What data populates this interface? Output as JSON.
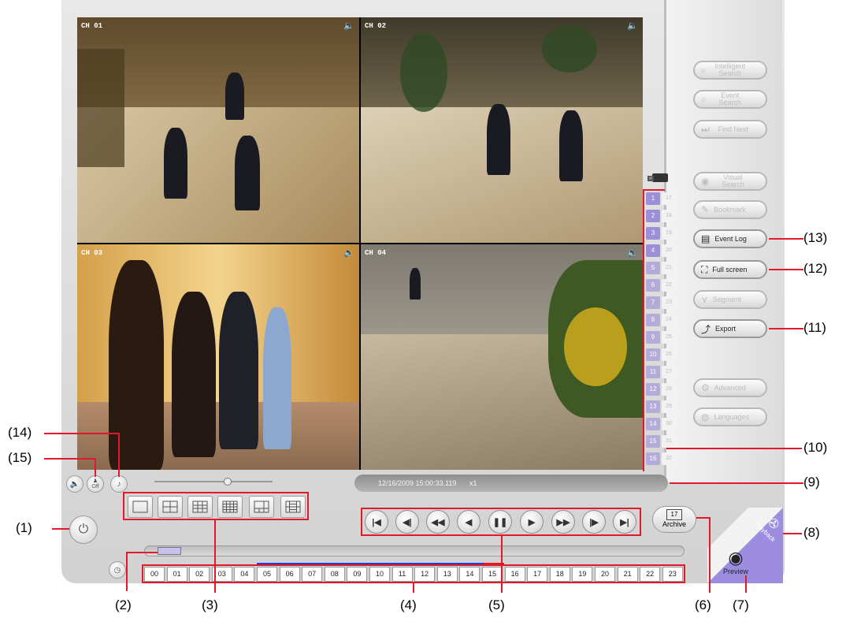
{
  "channels": {
    "cam1": {
      "label": "CH 01"
    },
    "cam2": {
      "label": "CH 02"
    },
    "cam3": {
      "label": "CH 03"
    },
    "cam4": {
      "label": "CH 04"
    },
    "audio_icon": "speaker-icon"
  },
  "status_bar": {
    "datetime": "12/16/2009 15:00:33.119",
    "speed": "x1"
  },
  "channel_list": {
    "primary": [
      "1",
      "2",
      "3",
      "4",
      "5",
      "6",
      "7",
      "8",
      "9",
      "10",
      "11",
      "12",
      "13",
      "14",
      "15",
      "16"
    ],
    "secondary": [
      "17",
      "18",
      "19",
      "20",
      "21",
      "22",
      "23",
      "24",
      "25",
      "26",
      "27",
      "28",
      "29",
      "30",
      "31",
      "32"
    ]
  },
  "side_buttons": {
    "intelligent_search": "Intelligent Search",
    "event_search": "Event Search",
    "find_next": "Find Next",
    "visual_search": "Visual Search",
    "bookmark": "Bookmark",
    "event_log": "Event Log",
    "full_screen": "Full screen",
    "segment": "Segment",
    "export": "Export",
    "advanced": "Advanced",
    "languages": "Languages"
  },
  "controls": {
    "off_label": "Off",
    "archive_label": "Archive",
    "archive_day": "17",
    "preview_label": "Preview",
    "playback_label": "Playback"
  },
  "timeline": {
    "hours": [
      "00",
      "01",
      "02",
      "03",
      "04",
      "05",
      "06",
      "07",
      "08",
      "09",
      "10",
      "11",
      "12",
      "13",
      "14",
      "15",
      "16",
      "17",
      "18",
      "19",
      "20",
      "21",
      "22",
      "23"
    ]
  },
  "callouts": {
    "c1": "(1)",
    "c2": "(2)",
    "c3": "(3)",
    "c4": "(4)",
    "c5": "(5)",
    "c6": "(6)",
    "c7": "(7)",
    "c8": "(8)",
    "c9": "(9)",
    "c10": "(10)",
    "c11": "(11)",
    "c12": "(12)",
    "c13": "(13)",
    "c14": "(14)",
    "c15": "(15)"
  },
  "colors": {
    "active_channel": "#9b8fd6",
    "inactive_channel": "#b9b0e8",
    "callout_line": "#e01a2a",
    "record_bar": "#1f3fd8"
  }
}
